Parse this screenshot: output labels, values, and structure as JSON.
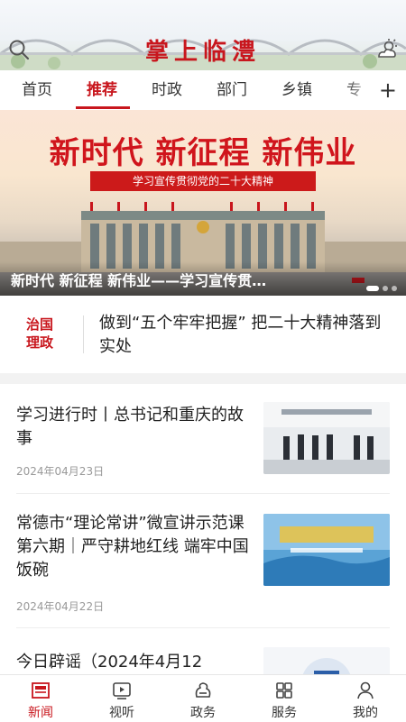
{
  "header": {
    "app_title": "掌上临澧"
  },
  "tabs": [
    {
      "label": "首页"
    },
    {
      "label": "推荐"
    },
    {
      "label": "时政"
    },
    {
      "label": "部门"
    },
    {
      "label": "乡镇"
    },
    {
      "label": "专"
    }
  ],
  "tab_add": "+",
  "banner": {
    "headline": "新时代 新征程 新伟业",
    "subline": "学习宣传贯彻党的二十大精神",
    "caption": "新时代 新征程 新伟业——学习宣传贯…"
  },
  "theory": {
    "logo_line1": "治国",
    "logo_line2": "理政",
    "text": "做到“五个牢牢把握” 把二十大精神落到实处"
  },
  "news": [
    {
      "title": "学习进行时丨总书记和重庆的故事",
      "date": "2024年04月23日"
    },
    {
      "title": "常德市“理论常讲”微宣讲示范课第六期｜严守耕地红线 端牢中国饭碗",
      "date": "2024年04月22日"
    },
    {
      "title": "今日辟谣（2024年4月12",
      "date": ""
    }
  ],
  "bottom_nav": [
    {
      "label": "新闻"
    },
    {
      "label": "视听"
    },
    {
      "label": "政务"
    },
    {
      "label": "服务"
    },
    {
      "label": "我的"
    }
  ],
  "colors": {
    "accent": "#c8161d"
  }
}
